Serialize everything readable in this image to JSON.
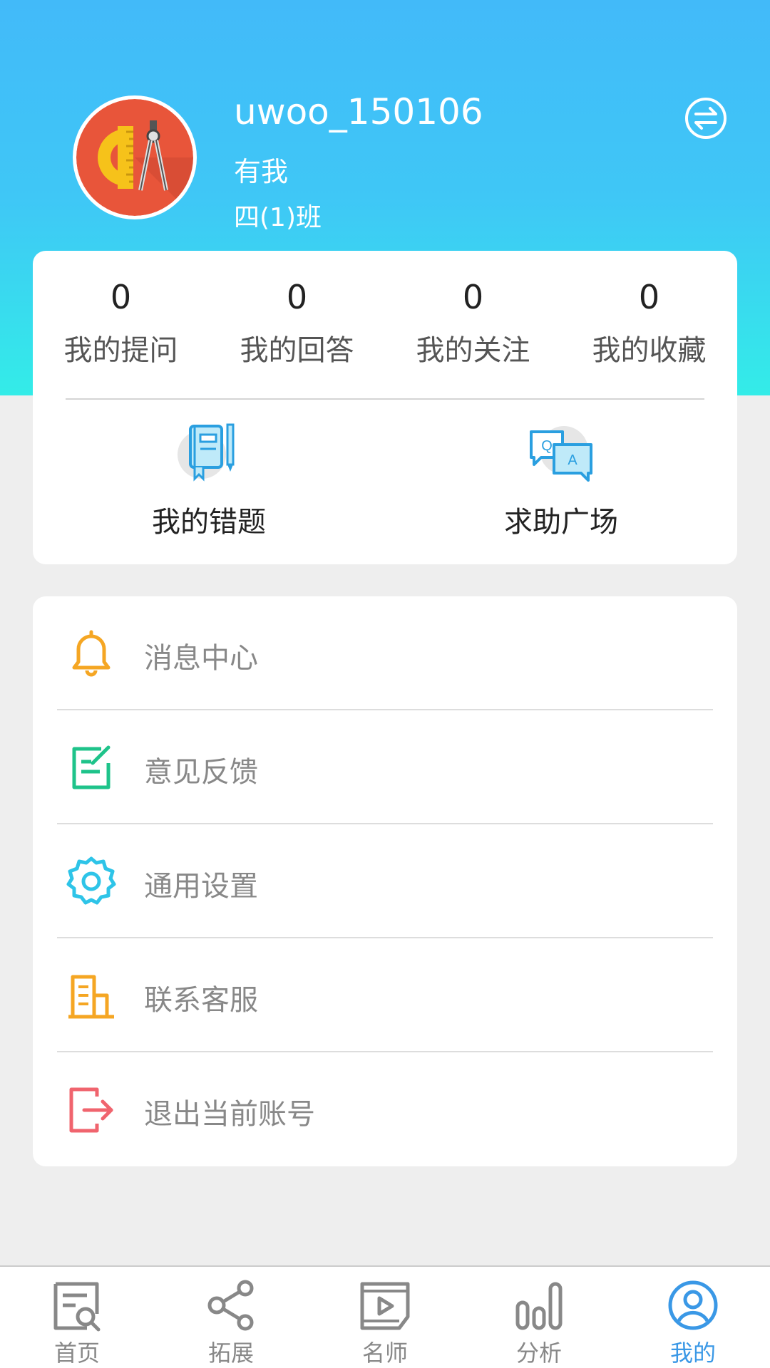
{
  "profile": {
    "username": "uwoo_150106",
    "nickname": "有我",
    "class_name": "四(1)班"
  },
  "stats": [
    {
      "value": "0",
      "label": "我的提问"
    },
    {
      "value": "0",
      "label": "我的回答"
    },
    {
      "value": "0",
      "label": "我的关注"
    },
    {
      "value": "0",
      "label": "我的收藏"
    }
  ],
  "quick_actions": [
    {
      "label": "我的错题",
      "icon": "notebook-icon"
    },
    {
      "label": "求助广场",
      "icon": "qa-chat-icon"
    }
  ],
  "menu": [
    {
      "label": "消息中心",
      "icon": "bell-icon",
      "color": "#f5a623"
    },
    {
      "label": "意见反馈",
      "icon": "edit-note-icon",
      "color": "#1ec38a"
    },
    {
      "label": "通用设置",
      "icon": "gear-icon",
      "color": "#2ec4e8"
    },
    {
      "label": "联系客服",
      "icon": "building-icon",
      "color": "#f5a623"
    },
    {
      "label": "退出当前账号",
      "icon": "logout-icon",
      "color": "#f0646e"
    }
  ],
  "tabs": [
    {
      "label": "首页",
      "icon": "document-search-icon"
    },
    {
      "label": "拓展",
      "icon": "share-icon"
    },
    {
      "label": "名师",
      "icon": "video-play-icon"
    },
    {
      "label": "分析",
      "icon": "bar-chart-icon"
    },
    {
      "label": "我的",
      "icon": "user-icon",
      "active": true
    }
  ],
  "colors": {
    "header_top": "#42baf9",
    "header_bottom": "#33ece8",
    "active_tab": "#3a98e6"
  }
}
